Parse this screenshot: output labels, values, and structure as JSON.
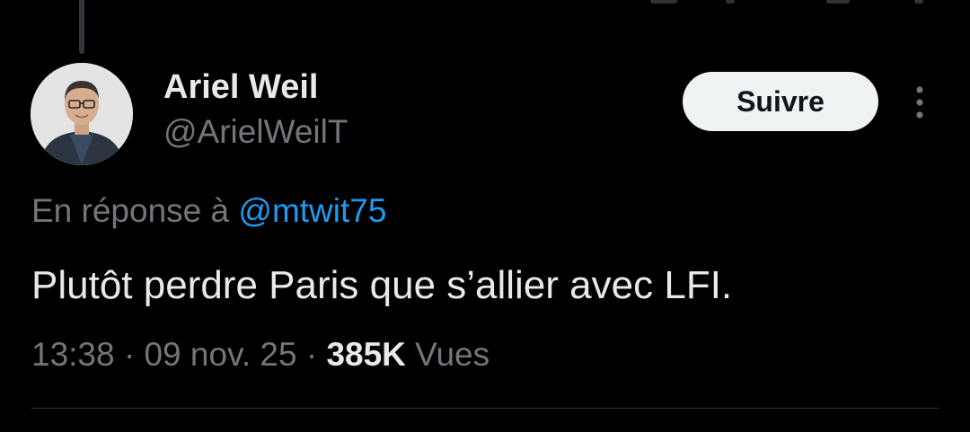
{
  "author": {
    "display_name": "Ariel Weil",
    "handle": "@ArielWeilT"
  },
  "actions": {
    "follow_label": "Suivre",
    "more_icon": "more-vertical-icon"
  },
  "reply": {
    "prefix": "En réponse à ",
    "handle": "@mtwit75"
  },
  "tweet": {
    "text": "Plutôt perdre Paris que s’allier avec LFI."
  },
  "meta": {
    "time": "13:38",
    "sep1": " · ",
    "date": "09 nov. 25",
    "sep2": " · ",
    "views_count": "385K",
    "views_label": " Vues"
  },
  "colors": {
    "background": "#000000",
    "text_primary": "#e7e9ea",
    "text_secondary": "#71767b",
    "link": "#1d9bf0",
    "follow_button_bg": "#eff3f4"
  }
}
